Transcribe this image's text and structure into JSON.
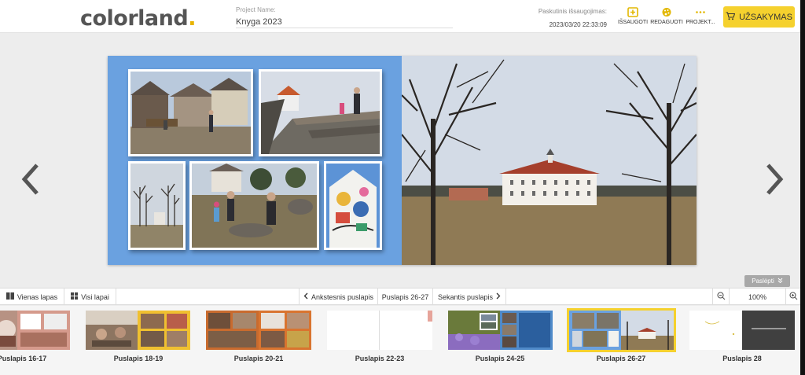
{
  "header": {
    "logo_text": "colorland",
    "logo_dot": ".",
    "project_label": "Project Name:",
    "project_name": "Knyga 2023",
    "last_saved_label": "Paskutinis išsaugojimas:",
    "last_saved_time": "2023/03/20 22:33:09",
    "save_label": "IŠSAUGOTI",
    "edit_label": "REDAGUOTI",
    "project_label_btn": "PROJEKT...",
    "order_label": "UŽSAKYMAS"
  },
  "colors": {
    "accent": "#f5d12e",
    "page_bg": "#6aa1e0"
  },
  "viewer": {
    "hide_label": "Paslėpti"
  },
  "toolbar": {
    "single_page": "Vienas lapas",
    "all_pages": "Visi lapai",
    "previous": "Ankstesnis puslapis",
    "current": "Puslapis 26-27",
    "next": "Sekantis puslapis",
    "zoom": "100%"
  },
  "thumbnails": [
    {
      "label": "Puslapis 16-17",
      "selected": false
    },
    {
      "label": "Puslapis 18-19",
      "selected": false
    },
    {
      "label": "Puslapis 20-21",
      "selected": false
    },
    {
      "label": "Puslapis 22-23",
      "selected": false
    },
    {
      "label": "Puslapis 24-25",
      "selected": false
    },
    {
      "label": "Puslapis 26-27",
      "selected": true
    },
    {
      "label": "Puslapis 28",
      "selected": false
    }
  ]
}
